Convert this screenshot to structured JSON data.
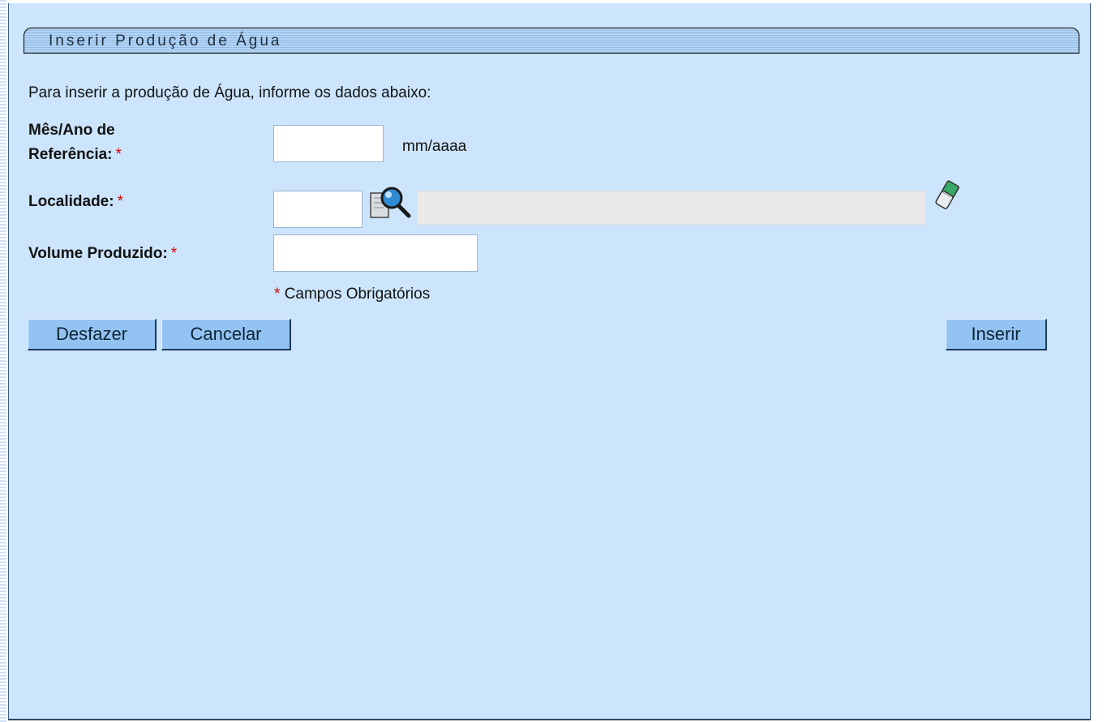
{
  "title": "Inserir Produção de Água",
  "instructions": "Para inserir a produção de Água, informe os dados abaixo:",
  "fields": {
    "mes_ano": {
      "label_line1": "Mês/Ano de",
      "label_line2": "Referência:",
      "required_mark": "*",
      "value": "",
      "format_hint": "mm/aaaa"
    },
    "localidade": {
      "label": "Localidade:",
      "required_mark": "*",
      "code_value": "",
      "description_value": ""
    },
    "volume": {
      "label": "Volume Produzido:",
      "required_mark": "*",
      "value": ""
    }
  },
  "required_note": {
    "mark": "*",
    "text": "Campos Obrigatórios"
  },
  "buttons": {
    "undo": "Desfazer",
    "cancel": "Cancelar",
    "insert": "Inserir"
  },
  "icons": {
    "lookup": "magnifier-search-icon",
    "clear": "eraser-icon"
  },
  "colors": {
    "panel_bg": "#cce5fc",
    "required": "#d40000",
    "button_bg": "#93c3f2"
  }
}
